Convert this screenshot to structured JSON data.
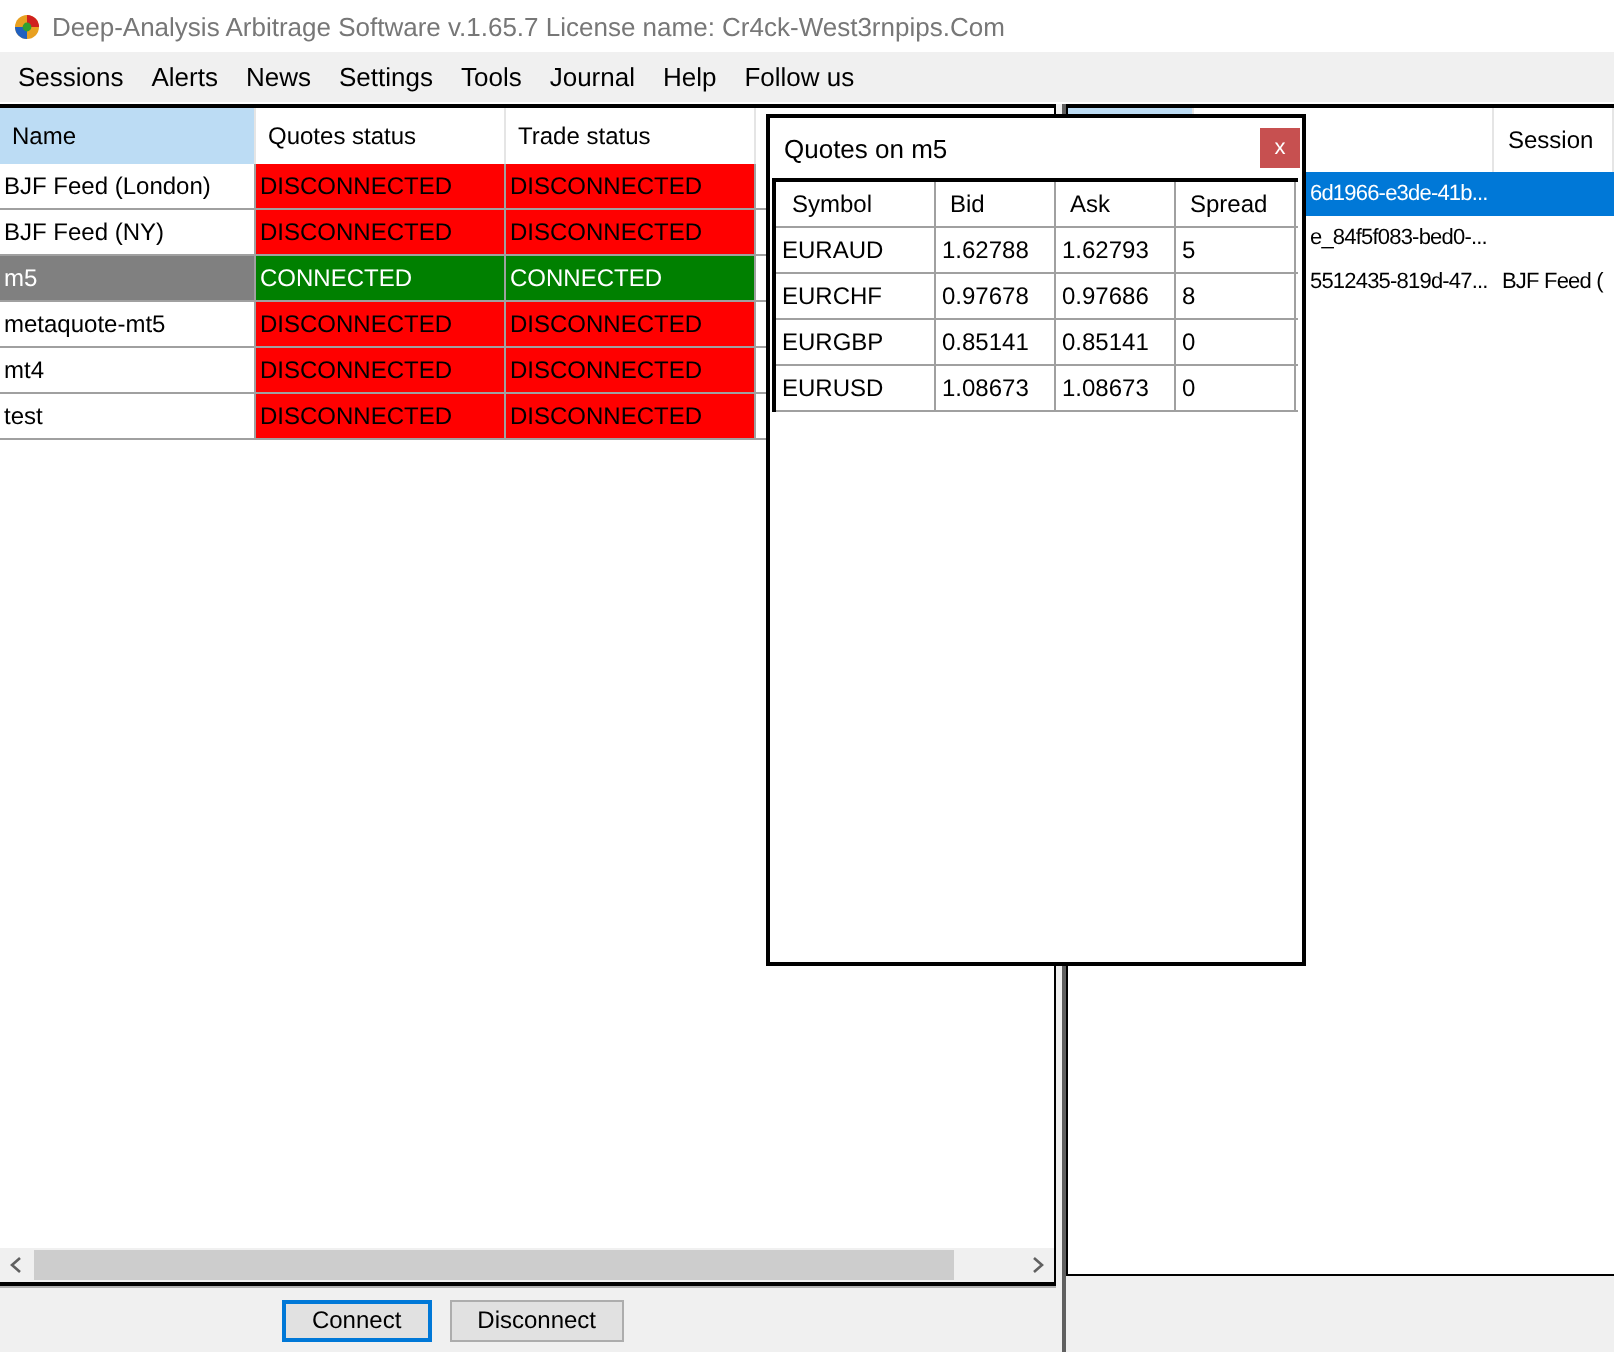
{
  "window": {
    "title": "Deep-Analysis Arbitrage Software v.1.65.7 License name: Cr4ck-West3rnpips.Com"
  },
  "menu": [
    "Sessions",
    "Alerts",
    "News",
    "Settings",
    "Tools",
    "Journal",
    "Help",
    "Follow us"
  ],
  "sessions_table": {
    "columns": [
      "Name",
      "Quotes status",
      "Trade status"
    ],
    "rows": [
      {
        "name": "BJF Feed (London)",
        "quotes_status": "DISCONNECTED",
        "quotes_connected": false,
        "trade_status": "DISCONNECTED",
        "trade_connected": false,
        "selected": false
      },
      {
        "name": "BJF Feed (NY)",
        "quotes_status": "DISCONNECTED",
        "quotes_connected": false,
        "trade_status": "DISCONNECTED",
        "trade_connected": false,
        "selected": false
      },
      {
        "name": "m5",
        "quotes_status": "CONNECTED",
        "quotes_connected": true,
        "trade_status": "CONNECTED",
        "trade_connected": true,
        "selected": true
      },
      {
        "name": "metaquote-mt5",
        "quotes_status": "DISCONNECTED",
        "quotes_connected": false,
        "trade_status": "DISCONNECTED",
        "trade_connected": false,
        "selected": false
      },
      {
        "name": "mt4",
        "quotes_status": "DISCONNECTED",
        "quotes_connected": false,
        "trade_status": "DISCONNECTED",
        "trade_connected": false,
        "selected": false
      },
      {
        "name": "test",
        "quotes_status": "DISCONNECTED",
        "quotes_connected": false,
        "trade_status": "DISCONNECTED",
        "trade_connected": false,
        "selected": false
      }
    ]
  },
  "buttons": [
    {
      "label": "Connect",
      "focused": true
    },
    {
      "label": "Disconnect",
      "focused": false
    }
  ],
  "right_table": {
    "columns": [
      "Session"
    ],
    "rows": [
      {
        "column_1": "6d1966-e3de-41b...",
        "session": "",
        "selected": true
      },
      {
        "column_1": "e_84f5f083-bed0-...",
        "session": "",
        "selected": false
      },
      {
        "column_1": "5512435-819d-47...",
        "session": "BJF Feed (",
        "selected": false
      }
    ]
  },
  "quotes_dialog": {
    "title": "Quotes on m5",
    "close": "x",
    "columns": [
      "Symbol",
      "Bid",
      "Ask",
      "Spread"
    ],
    "rows": [
      [
        "EURAUD",
        "1.62788",
        "1.62793",
        "5"
      ],
      [
        "EURCHF",
        "0.97678",
        "0.97686",
        "8"
      ],
      [
        "EURGBP",
        "0.85141",
        "0.85141",
        "0"
      ],
      [
        "EURUSD",
        "1.08673",
        "1.08673",
        "0"
      ]
    ]
  }
}
